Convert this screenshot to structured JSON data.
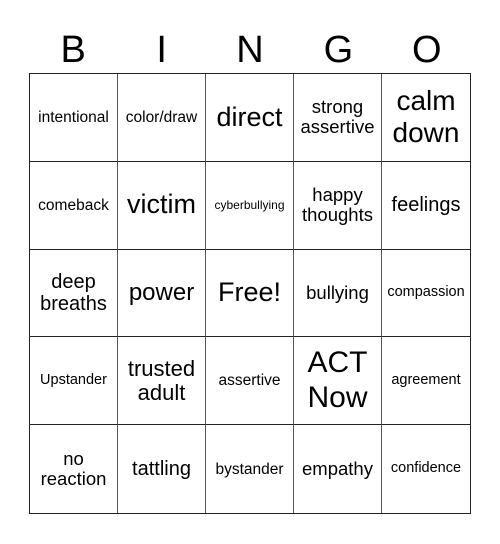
{
  "header": [
    "B",
    "I",
    "N",
    "G",
    "O"
  ],
  "cells": [
    "intentional",
    "color/draw",
    "direct",
    "strong assertive",
    "calm down",
    "comeback",
    "victim",
    "cyberbullying",
    "happy thoughts",
    "feelings",
    "deep breaths",
    "power",
    "Free!",
    "bullying",
    "compassion",
    "Upstander",
    "trusted adult",
    "assertive",
    "ACT Now",
    "agreement",
    "no reaction",
    "tattling",
    "bystander",
    "empathy",
    "confidence"
  ]
}
